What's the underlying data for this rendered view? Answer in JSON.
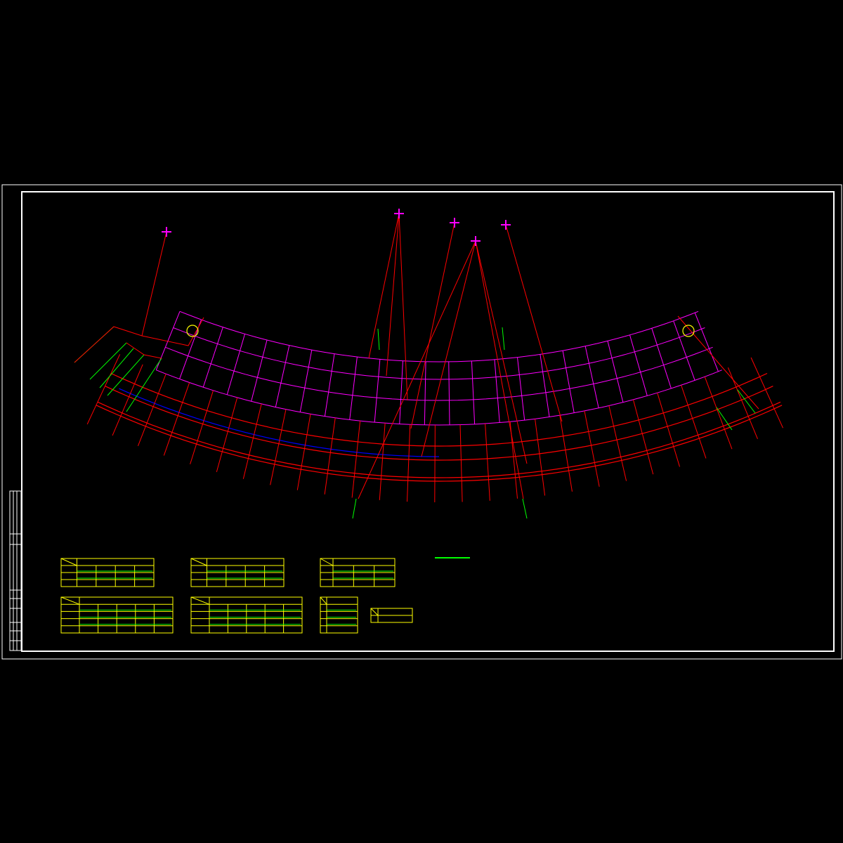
{
  "colors": {
    "background": "#000000",
    "frame": "#ffffff",
    "magenta": "#ff00ff",
    "red": "#ff0000",
    "green": "#00ff00",
    "blue": "#0000ff",
    "yellow": "#ffff00"
  },
  "drawing": {
    "survey_points": 5,
    "tables_top_row": 3,
    "tables_bottom_row": 4
  }
}
